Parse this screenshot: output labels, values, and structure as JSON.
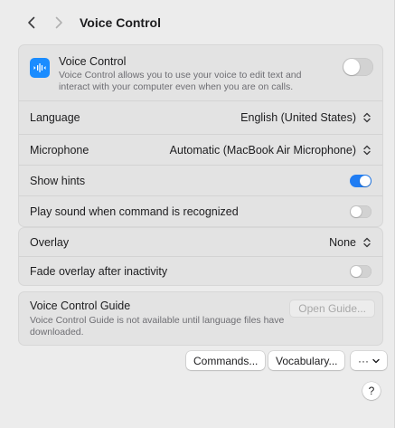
{
  "header": {
    "back_icon": "chevron-left-icon",
    "forward_icon": "chevron-right-icon",
    "title": "Voice Control"
  },
  "voice_control": {
    "icon": "voice-control-waveform-icon",
    "icon_color": "#1a8cff",
    "title": "Voice Control",
    "description": "Voice Control allows you to use your voice to edit text and interact with your computer even when you are on calls.",
    "enabled": false
  },
  "settings": {
    "language": {
      "label": "Language",
      "value": "English (United States)"
    },
    "microphone": {
      "label": "Microphone",
      "value": "Automatic (MacBook Air Microphone)"
    },
    "show_hints": {
      "label": "Show hints",
      "enabled": true
    },
    "play_sound": {
      "label": "Play sound when command is recognized",
      "enabled": false
    }
  },
  "overlay_settings": {
    "overlay": {
      "label": "Overlay",
      "value": "None"
    },
    "fade": {
      "label": "Fade overlay after inactivity",
      "enabled": false
    }
  },
  "guide": {
    "title": "Voice Control Guide",
    "description": "Voice Control Guide is not available until language files have downloaded.",
    "button_label": "Open Guide..."
  },
  "actions": {
    "commands_label": "Commands...",
    "vocabulary_label": "Vocabulary...",
    "more_label": "···",
    "help_label": "?"
  },
  "colors": {
    "accent": "#1f7cf3",
    "background": "#ececec",
    "group_background": "#e3e3e3"
  }
}
